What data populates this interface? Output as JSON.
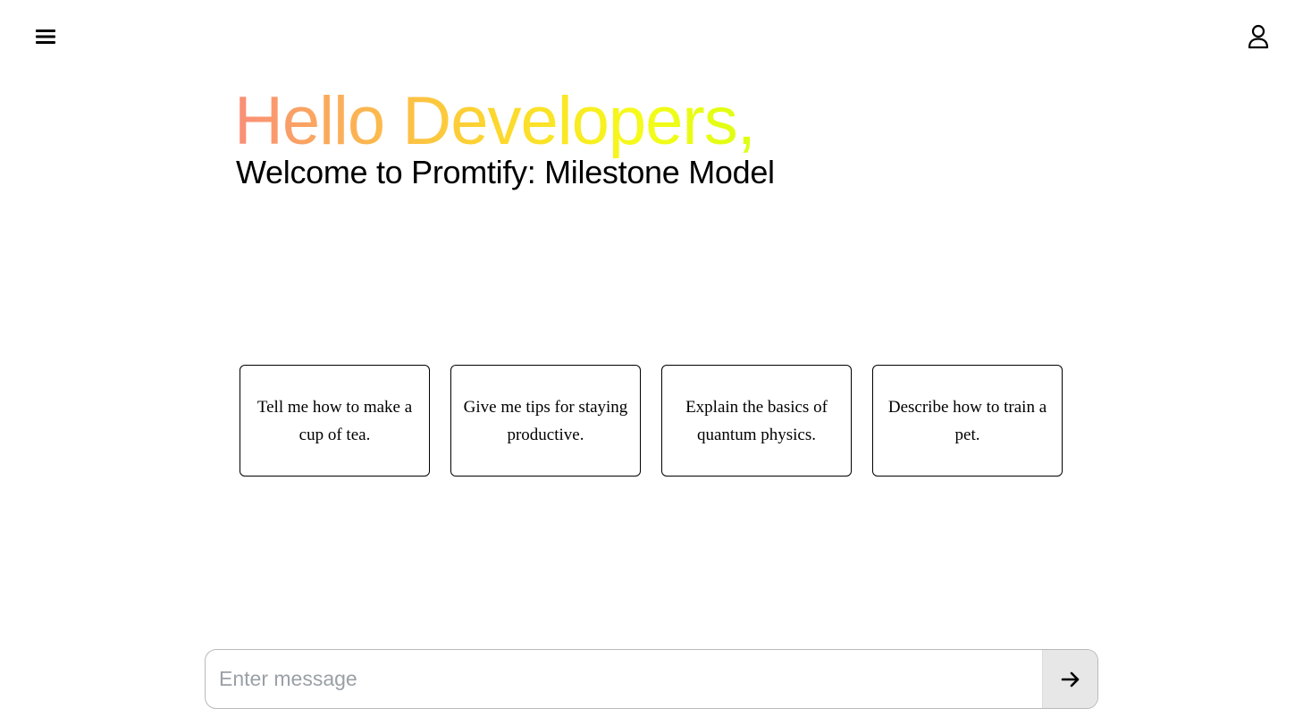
{
  "header": {
    "menu_icon": "hamburger-menu-icon",
    "user_icon": "user-profile-icon"
  },
  "hero": {
    "title": "Hello Developers,",
    "subtitle": "Welcome to Promtify: Milestone Model",
    "gradient_colors": [
      "#f98e78",
      "#fcb750",
      "#fdd92c",
      "#f5fb1a",
      "#d8ff10"
    ]
  },
  "suggestions": [
    {
      "text": "Tell me how to make a cup of tea."
    },
    {
      "text": "Give me tips for staying productive."
    },
    {
      "text": "Explain the basics of quantum physics."
    },
    {
      "text": "Describe how to train a pet."
    }
  ],
  "composer": {
    "placeholder": "Enter message",
    "value": "",
    "send_icon": "arrow-right-icon"
  }
}
